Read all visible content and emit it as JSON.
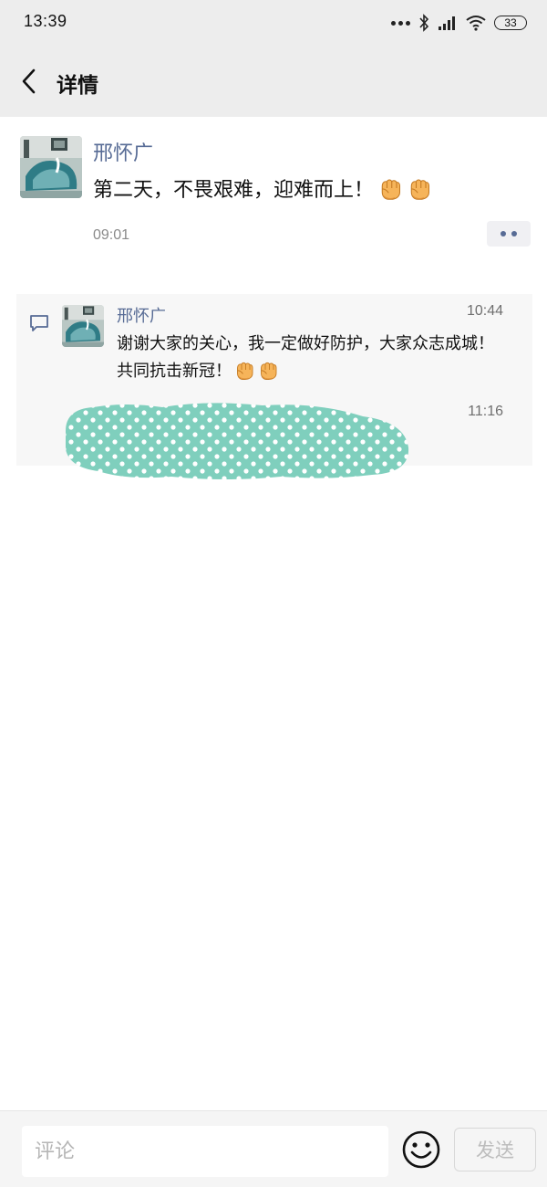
{
  "status_bar": {
    "time": "13:39",
    "battery": "33",
    "icons": [
      "dots-icon",
      "bluetooth-icon",
      "signal-icon",
      "wifi-icon",
      "battery-icon"
    ]
  },
  "nav": {
    "title": "详情",
    "back_icon": "chevron-left-icon"
  },
  "post": {
    "author": "邢怀广",
    "text": "第二天，不畏艰难，迎难而上！",
    "emojis": [
      "fist-emoji",
      "fist-emoji"
    ],
    "time": "09:01",
    "more_icon": "more-dots-icon"
  },
  "comments": [
    {
      "author": "邢怀广",
      "time": "10:44",
      "text": "谢谢大家的关心，我一定做好防护，大家众志成城！共同抗击新冠！",
      "emojis": [
        "fist-emoji",
        "fist-emoji"
      ]
    },
    {
      "time": "11:16",
      "redacted": true
    }
  ],
  "bottom_bar": {
    "comment_placeholder": "评论",
    "comment_value": "",
    "emoji_icon": "smiley-icon",
    "send_label": "发送"
  },
  "colors": {
    "link_blue": "#576b95",
    "header_bg": "#ededed",
    "comment_bg": "#f7f7f7",
    "redaction_teal": "#7fcfbd"
  }
}
